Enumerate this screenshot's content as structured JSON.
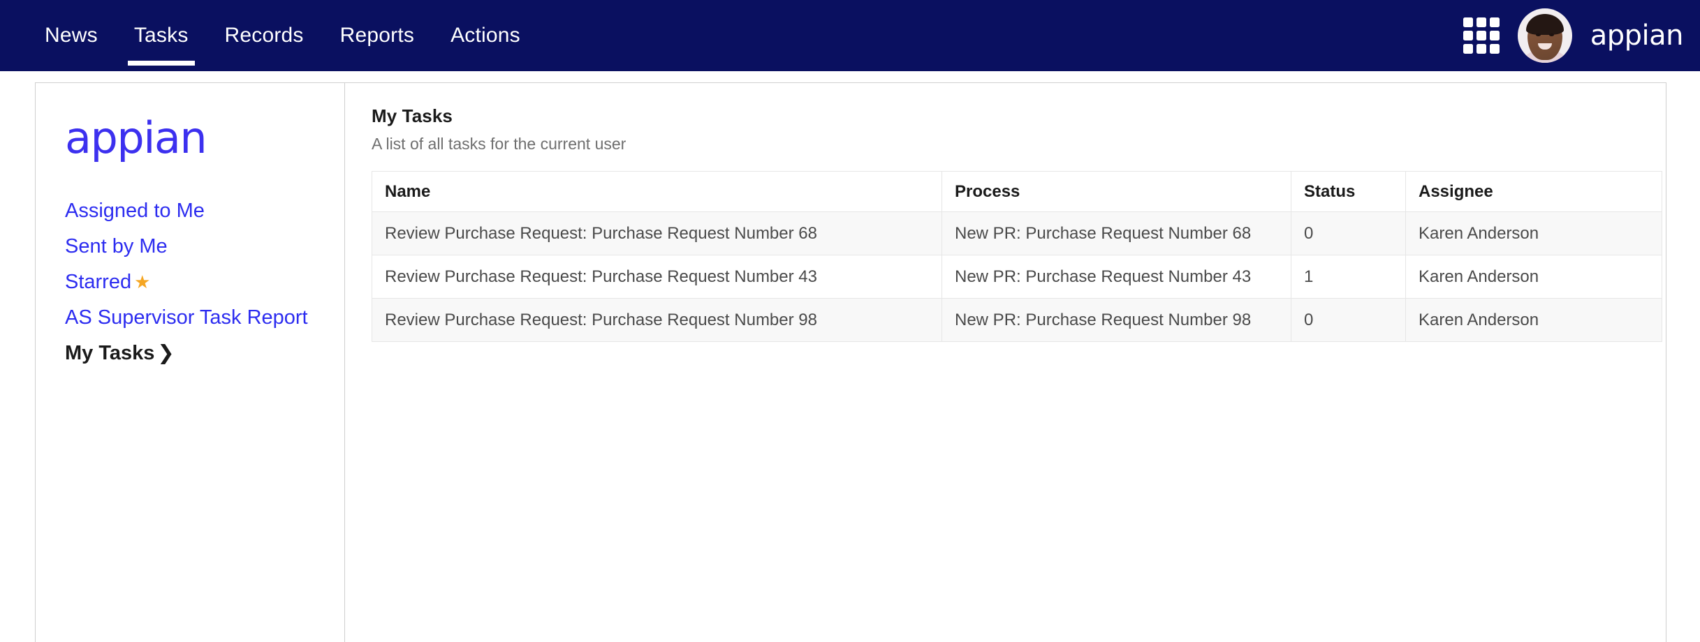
{
  "brand": {
    "wordmark": "appian",
    "header_wordmark_color": "#ffffff",
    "sidebar_wordmark_color": "#3c30ef",
    "nav_background": "#0a1060"
  },
  "topnav": {
    "items": [
      {
        "label": "News",
        "active": false
      },
      {
        "label": "Tasks",
        "active": true
      },
      {
        "label": "Records",
        "active": false
      },
      {
        "label": "Reports",
        "active": false
      },
      {
        "label": "Actions",
        "active": false
      }
    ],
    "grid_icon": "grid-apps-icon",
    "avatar": "user-avatar"
  },
  "sidebar": {
    "logo": "appian",
    "items": [
      {
        "label": "Assigned to Me",
        "current": false,
        "icon": null
      },
      {
        "label": "Sent by Me",
        "current": false,
        "icon": null
      },
      {
        "label": "Starred",
        "current": false,
        "icon": "star-icon"
      },
      {
        "label": "AS Supervisor Task Report",
        "current": false,
        "icon": null
      },
      {
        "label": "My Tasks",
        "current": true,
        "icon": "chevron-right-icon"
      }
    ],
    "star_glyph": "★",
    "chevron_glyph": "❯"
  },
  "main": {
    "title": "My Tasks",
    "subtitle": "A list of all tasks for the current user",
    "table": {
      "columns": [
        "Name",
        "Process",
        "Status",
        "Assignee"
      ],
      "rows": [
        {
          "name": "Review Purchase Request: Purchase Request Number 68",
          "process": "New PR: Purchase Request Number 68",
          "status": "0",
          "assignee": "Karen Anderson"
        },
        {
          "name": "Review Purchase Request: Purchase Request Number 43",
          "process": "New PR: Purchase Request Number 43",
          "status": "1",
          "assignee": "Karen Anderson"
        },
        {
          "name": "Review Purchase Request: Purchase Request Number 98",
          "process": "New PR: Purchase Request Number 98",
          "status": "0",
          "assignee": "Karen Anderson"
        }
      ]
    }
  }
}
